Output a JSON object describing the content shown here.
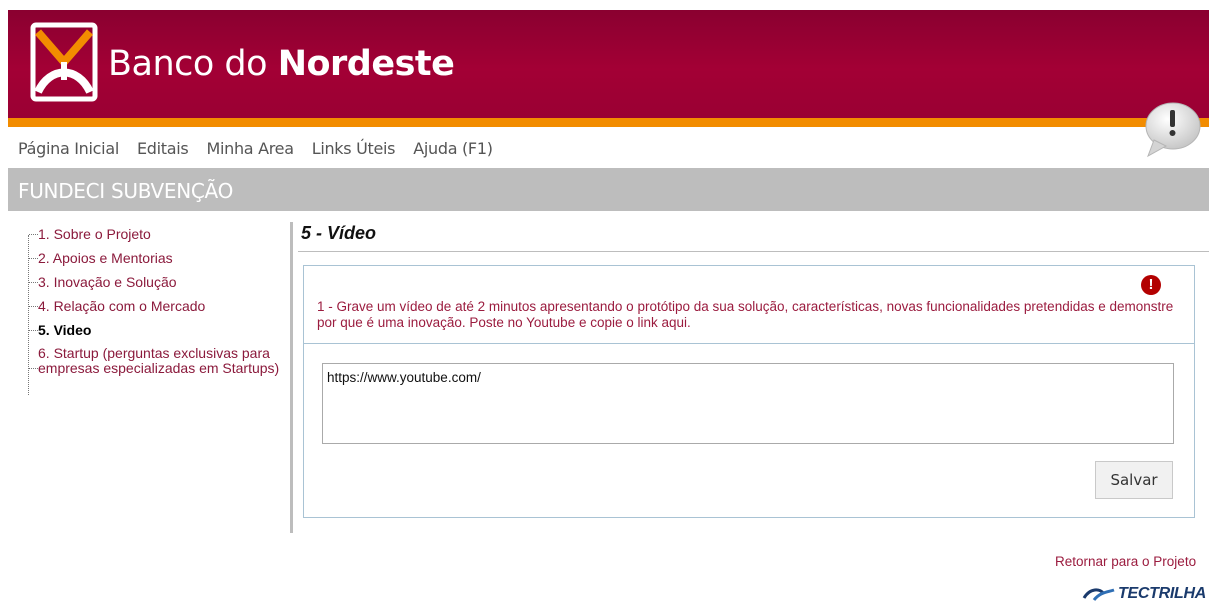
{
  "brand": {
    "name_light": "Banco do ",
    "name_bold": "Nordeste",
    "colors": {
      "header": "#a30035",
      "accent": "#f28c00",
      "link": "#9b1c3f"
    }
  },
  "topnav": {
    "items": [
      {
        "label": "Página Inicial"
      },
      {
        "label": "Editais"
      },
      {
        "label": "Minha Area"
      },
      {
        "label": "Links Úteis"
      },
      {
        "label": "Ajuda (F1)"
      }
    ]
  },
  "section": {
    "title": "FUNDECI SUBVENÇÃO"
  },
  "sidebar": {
    "items": [
      {
        "label": "1. Sobre o Projeto"
      },
      {
        "label": "2. Apoios e Mentorias"
      },
      {
        "label": "3. Inovação e Solução"
      },
      {
        "label": "4. Relação com o Mercado"
      },
      {
        "label": "5. Video"
      },
      {
        "label": "6. Startup (perguntas exclusivas para empresas especializadas em Startups)"
      }
    ]
  },
  "main": {
    "title": "5 - Vídeo",
    "question": "1 - Grave um vídeo de até 2 minutos apresentando o protótipo da sua solução, características, novas funcionalidades pretendidas e demonstre por que é uma inovação. Poste no Youtube e copie o link aqui.",
    "answer_value": "https://www.youtube.com/",
    "alert_glyph": "!",
    "save_label": "Salvar"
  },
  "footer": {
    "return_label": "Retornar para o Projeto",
    "vendor": "TECTRILHA"
  }
}
